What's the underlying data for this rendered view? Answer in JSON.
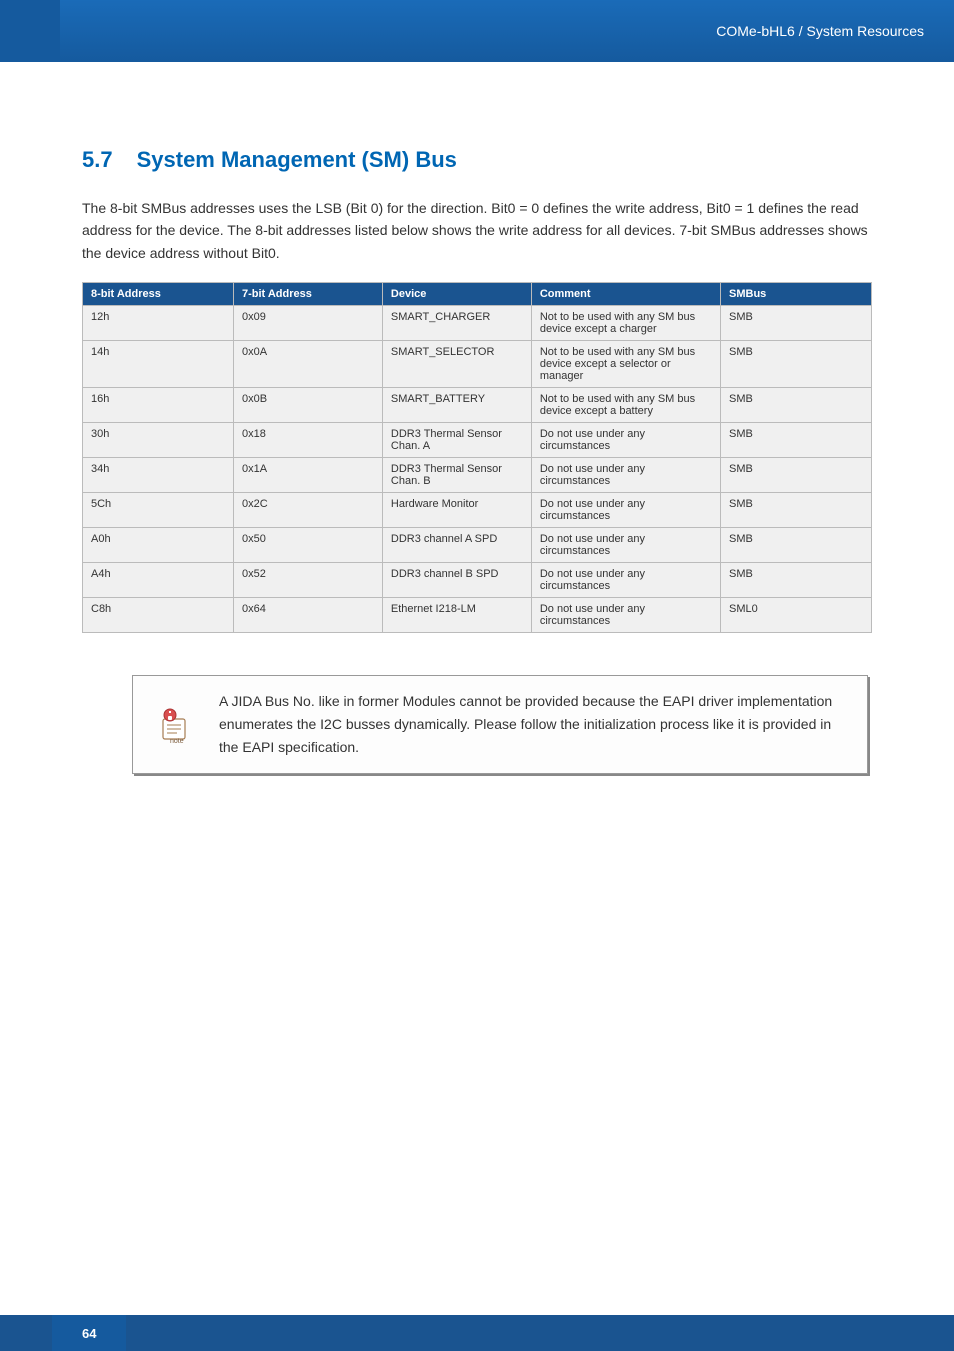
{
  "header": {
    "breadcrumb": "COMe-bHL6 / System Resources"
  },
  "section": {
    "number": "5.7",
    "title": "System Management (SM) Bus",
    "intro": "The 8-bit SMBus addresses uses the LSB (Bit 0) for the direction. Bit0 = 0 defines the write address, Bit0 = 1 defines the read address for the device. The 8-bit addresses listed below shows the write address for all devices. 7-bit SMBus addresses shows the device address without Bit0."
  },
  "table": {
    "headers": {
      "addr8": "8-bit Address",
      "addr7": "7-bit Address",
      "device": "Device",
      "comment": "Comment",
      "smbus": "SMBus"
    },
    "rows": [
      {
        "addr8": "12h",
        "addr7": "0x09",
        "device": "SMART_CHARGER",
        "comment": "Not to be used with any SM bus device except a charger",
        "smbus": "SMB"
      },
      {
        "addr8": "14h",
        "addr7": "0x0A",
        "device": "SMART_SELECTOR",
        "comment": "Not to be used with any SM bus device except a selector or manager",
        "smbus": "SMB"
      },
      {
        "addr8": "16h",
        "addr7": "0x0B",
        "device": "SMART_BATTERY",
        "comment": "Not to be used with any SM bus device except a battery",
        "smbus": "SMB"
      },
      {
        "addr8": "30h",
        "addr7": "0x18",
        "device": "DDR3 Thermal Sensor Chan. A",
        "comment": "Do not use under any circumstances",
        "smbus": "SMB"
      },
      {
        "addr8": "34h",
        "addr7": "0x1A",
        "device": "DDR3 Thermal Sensor Chan. B",
        "comment": "Do not use under any circumstances",
        "smbus": "SMB"
      },
      {
        "addr8": "5Ch",
        "addr7": "0x2C",
        "device": "Hardware Monitor",
        "comment": "Do not use under any circumstances",
        "smbus": "SMB"
      },
      {
        "addr8": "A0h",
        "addr7": "0x50",
        "device": "DDR3 channel A SPD",
        "comment": "Do not use under any circumstances",
        "smbus": "SMB"
      },
      {
        "addr8": "A4h",
        "addr7": "0x52",
        "device": "DDR3 channel B SPD",
        "comment": "Do not use under any circumstances",
        "smbus": "SMB"
      },
      {
        "addr8": "C8h",
        "addr7": "0x64",
        "device": "Ethernet I218-LM",
        "comment": "Do not use under any circumstances",
        "smbus": "SML0"
      }
    ]
  },
  "note": {
    "text": "A JIDA Bus No. like in former Modules cannot be provided because the EAPI driver implementation enumerates the I2C busses dynamically. Please follow the initialization process like it is provided in the EAPI specification."
  },
  "footer": {
    "page": "64"
  }
}
